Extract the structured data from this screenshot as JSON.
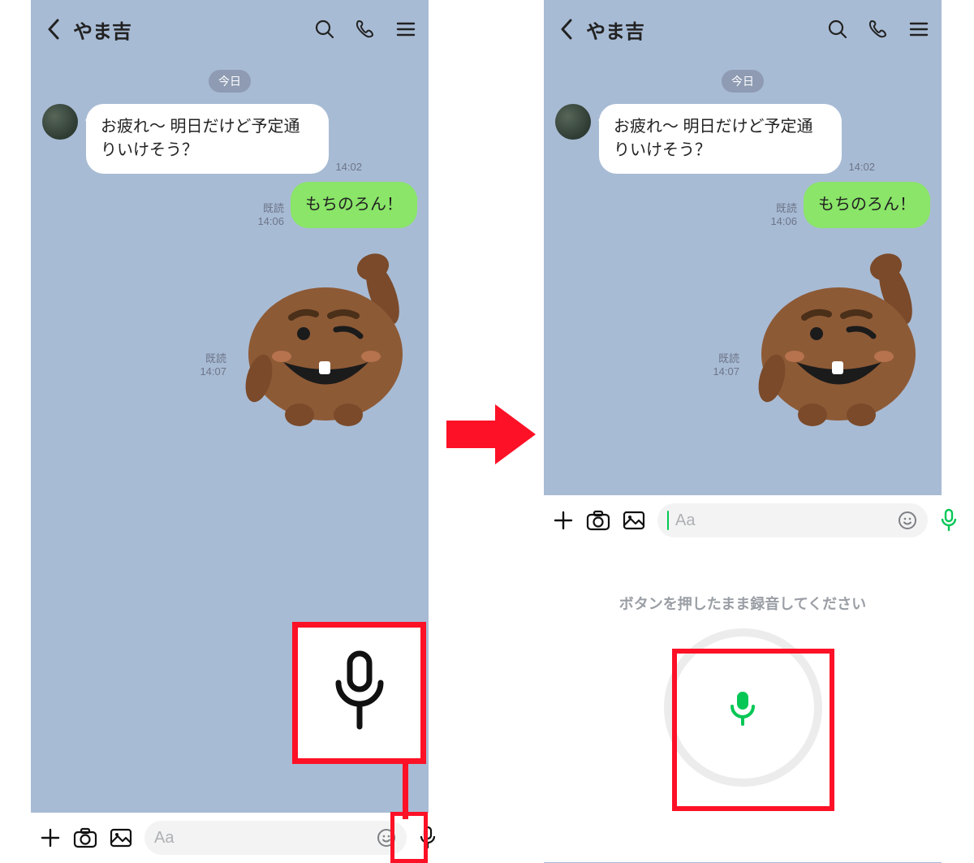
{
  "chat_name": "やま吉",
  "date_label": "今日",
  "messages": {
    "them_text": "お疲れ〜 明日だけど予定通りいけそう？",
    "them_time": "14:02",
    "me_text": "もちのろん！",
    "me_read": "既読",
    "me_time": "14:06",
    "sticker_read": "既読",
    "sticker_time": "14:07"
  },
  "input_placeholder": "Aa",
  "voice_panel_label": "ボタンを押したまま録音してください",
  "colors": {
    "accent_green": "#06c755",
    "my_bubble": "#8ae568",
    "highlight_red": "#fc1126"
  }
}
